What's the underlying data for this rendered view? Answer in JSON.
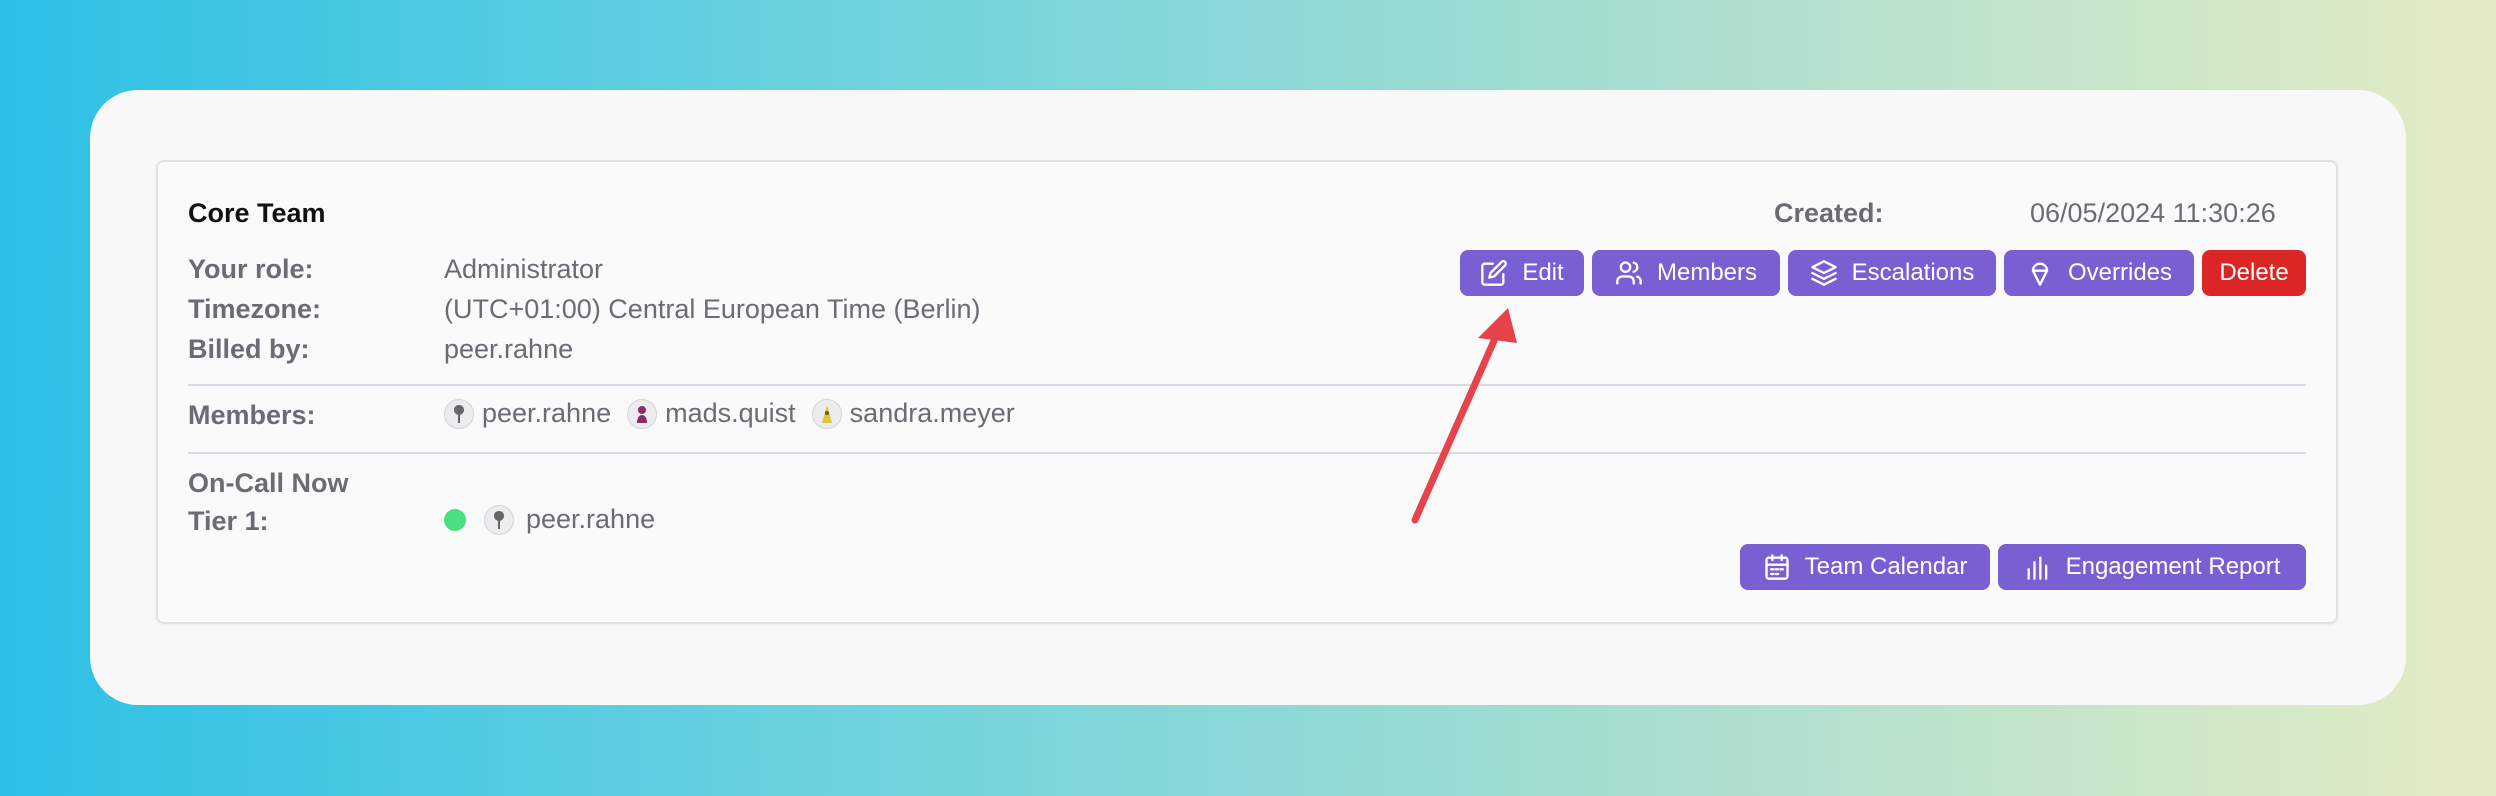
{
  "team": {
    "name": "Core Team",
    "created_label": "Created:",
    "created_value": "06/05/2024 11:30:26",
    "role_label": "Your role:",
    "role_value": "Administrator",
    "timezone_label": "Timezone:",
    "timezone_value": "(UTC+01:00) Central European Time (Berlin)",
    "billed_label": "Billed by:",
    "billed_value": "peer.rahne"
  },
  "actions": {
    "edit": "Edit",
    "members": "Members",
    "escalations": "Escalations",
    "overrides": "Overrides",
    "delete": "Delete"
  },
  "members": {
    "label": "Members:",
    "list": [
      "peer.rahne",
      "mads.quist",
      "sandra.meyer"
    ]
  },
  "oncall": {
    "heading": "On-Call Now",
    "tier_label": "Tier 1:",
    "tier_user": "peer.rahne",
    "status_color": "#4ade80"
  },
  "footer_actions": {
    "calendar": "Team Calendar",
    "report": "Engagement Report"
  },
  "colors": {
    "accent": "#7a5fd2",
    "danger": "#dc2626",
    "annotation_arrow": "#e8434a"
  },
  "icons": {
    "edit": "edit-icon",
    "members": "users-icon",
    "escalations": "layers-icon",
    "overrides": "ice-cream-icon",
    "calendar": "calendar-icon",
    "report": "bar-chart-icon"
  }
}
